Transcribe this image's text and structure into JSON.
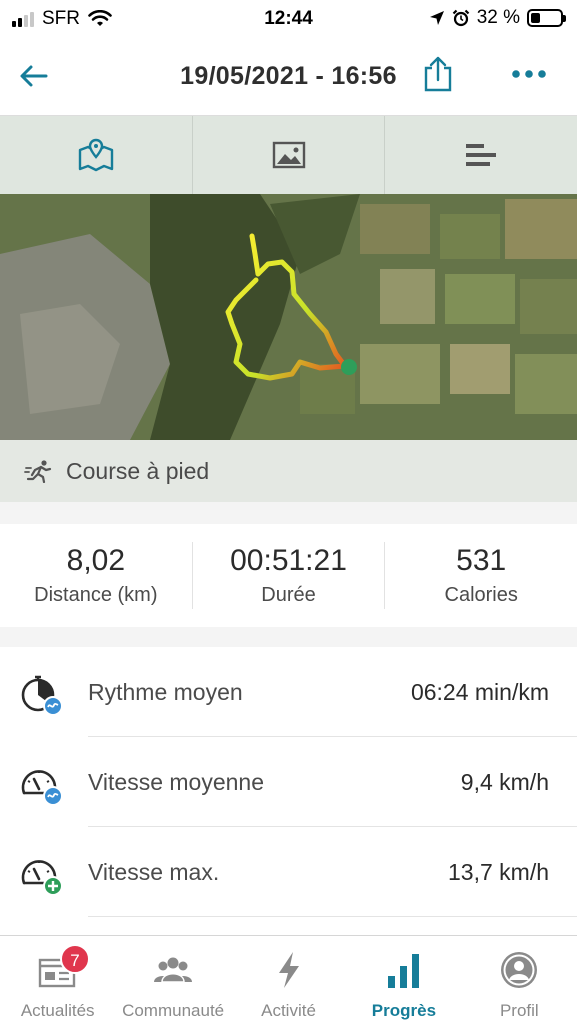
{
  "status_bar": {
    "carrier": "SFR",
    "time": "12:44",
    "battery_percent": "32 %",
    "battery_level": 0.32
  },
  "header": {
    "title": "19/05/2021 - 16:56",
    "icons": {
      "back": "back-arrow-icon",
      "share": "share-icon",
      "more": "more-dots-icon"
    }
  },
  "view_tabs": [
    {
      "icon": "map-icon",
      "active": true
    },
    {
      "icon": "photo-icon",
      "active": false
    },
    {
      "icon": "list-icon",
      "active": false
    }
  ],
  "activity": {
    "type": "Course à pied",
    "icon": "running-icon"
  },
  "summary": {
    "distance_value": "8,02",
    "distance_label": "Distance (km)",
    "duration_value": "00:51:21",
    "duration_label": "Durée",
    "calories_value": "531",
    "calories_label": "Calories"
  },
  "metrics": [
    {
      "label": "Rythme moyen",
      "value": "06:24 min/km",
      "icon": "pace-average-icon"
    },
    {
      "label": "Vitesse moyenne",
      "value": "9,4 km/h",
      "icon": "speed-average-icon"
    },
    {
      "label": "Vitesse max.",
      "value": "13,7 km/h",
      "icon": "speed-max-icon"
    }
  ],
  "tab_bar": [
    {
      "label": "Actualités",
      "icon": "news-icon",
      "badge": "7",
      "active": false
    },
    {
      "label": "Communauté",
      "icon": "community-icon",
      "active": false
    },
    {
      "label": "Activité",
      "icon": "lightning-icon",
      "active": false
    },
    {
      "label": "Progrès",
      "icon": "progress-bars-icon",
      "active": true
    },
    {
      "label": "Profil",
      "icon": "profile-icon",
      "active": false
    }
  ],
  "colors": {
    "accent": "#167d99",
    "badge": "#e0364d",
    "route_start": "#ffee33",
    "route_end": "#e84a1f",
    "end_marker": "#2e9e5a"
  }
}
